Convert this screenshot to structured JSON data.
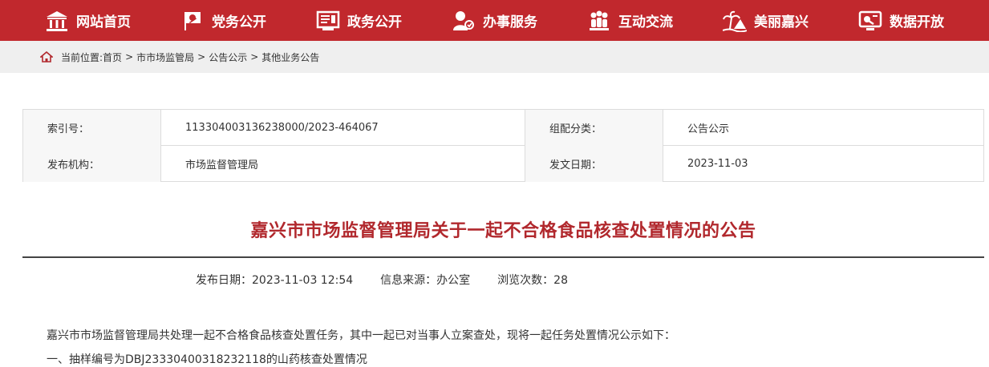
{
  "nav": {
    "items": [
      {
        "label": "网站首页",
        "icon": "government-building-icon"
      },
      {
        "label": "党务公开",
        "icon": "party-flag-icon"
      },
      {
        "label": "政务公开",
        "icon": "document-board-icon"
      },
      {
        "label": "办事服务",
        "icon": "service-person-icon"
      },
      {
        "label": "互动交流",
        "icon": "people-group-icon"
      },
      {
        "label": "美丽嘉兴",
        "icon": "palm-island-icon"
      },
      {
        "label": "数据开放",
        "icon": "data-monitor-icon"
      }
    ]
  },
  "breadcrumb": {
    "prefix": "当前位置:",
    "items": [
      "首页",
      "市市场监管局",
      "公告公示",
      "其他业务公告"
    ],
    "separator": ">"
  },
  "meta": {
    "index_label": "索引号：",
    "index_value": "113304003136238000/2023-464067",
    "category_label": "组配分类：",
    "category_value": "公告公示",
    "publisher_label": "发布机构：",
    "publisher_value": "市场监督管理局",
    "date_label": "发文日期：",
    "date_value": "2023-11-03"
  },
  "article": {
    "title": "嘉兴市市场监督管理局关于一起不合格食品核查处置情况的公告",
    "publish_time": "发布日期：2023-11-03 12:54",
    "source": "信息来源：办公室",
    "views": "浏览次数：28",
    "paragraph1": "嘉兴市市场监督管理局共处理一起不合格食品核查处置任务，其中一起已对当事人立案查处，现将一起任务处置情况公示如下：",
    "paragraph2": "一、抽样编号为DBJ23330400318232118的山药核查处置情况"
  },
  "colors": {
    "nav_bg": "#c1282d",
    "title": "#b1282d",
    "crumb_bg": "#efefef"
  }
}
